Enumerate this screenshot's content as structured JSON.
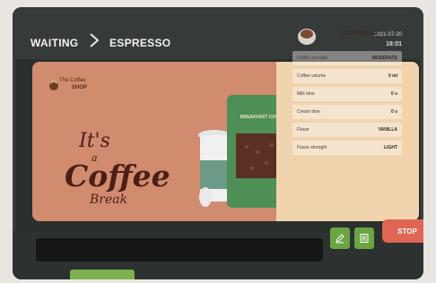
{
  "header": {
    "status": "WAITING",
    "mode": "ESPRESSO",
    "date": "2021-07-20",
    "time": "18:01"
  },
  "promo": {
    "brand_small": "The Coffee",
    "brand_main": "SHOP",
    "line1": "It's",
    "line2": "a",
    "line3": "Coffee",
    "line4": "Break",
    "bag_label": "BREAKFAST COFFEE"
  },
  "product": {
    "title": "ESPRESSO"
  },
  "settings": {
    "coffee_strength_label": "Coffee strength",
    "coffee_strength_value": "MODERATE",
    "coffee_volume_label": "Coffee volume",
    "coffee_volume_value": "0 ml",
    "milk_time_label": "Milk time",
    "milk_time_value": "0 s",
    "cream_time_label": "Cream time",
    "cream_time_value": "0 s",
    "flavor_label": "Flavor",
    "flavor_value": "VANILLA",
    "flavor_strength_label": "Flavor strength",
    "flavor_strength_value": "LIGHT"
  },
  "buttons": {
    "stop": "STOP"
  },
  "icons": {
    "edit": "pencil-icon",
    "notes": "notes-icon",
    "cup": "coffee-cup-icon"
  },
  "colors": {
    "accent_green": "#6aa443",
    "stop_red": "#df6655",
    "panel_orange": "#d18b6f",
    "info_beige": "#efd4ae"
  }
}
